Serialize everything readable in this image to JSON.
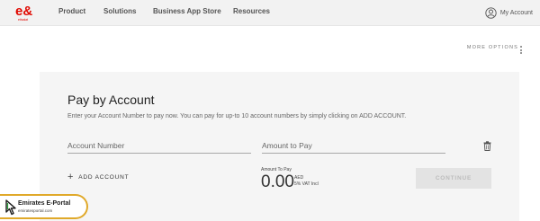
{
  "header": {
    "nav": [
      "Product",
      "Solutions",
      "Business App Store",
      "Resources"
    ],
    "account_label": "My Account"
  },
  "more_options_label": "MORE OPTIONS",
  "card": {
    "title": "Pay by Account",
    "subtitle": "Enter your Account Number to pay now. You can pay for up-to 10 account numbers by simply clicking on ADD ACCOUNT.",
    "account_number_placeholder": "Account Number",
    "amount_placeholder": "Amount to Pay",
    "add_account_label": "ADD ACCOUNT",
    "amount_to_pay_label": "Amount To Pay",
    "amount_value": "0.00",
    "currency": "AED",
    "vat_note": "5% VAT Incl",
    "continue_label": "CONTINUE"
  },
  "watermark": {
    "title": "Emirates E-Portal",
    "url": "emiratesportal.com"
  },
  "colors": {
    "brand": "#e00800",
    "header_bg": "#f2f2f2",
    "card_bg": "#f5f5f5",
    "badge_border": "#e0a92a"
  }
}
